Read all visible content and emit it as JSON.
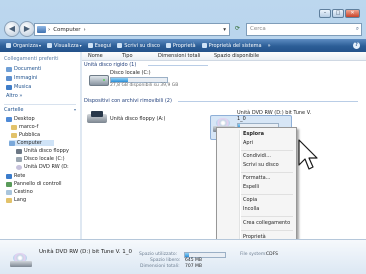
{
  "address": {
    "path": "Computer",
    "separator": "›"
  },
  "search": {
    "placeholder": "Cerca"
  },
  "caption_buttons": {
    "minimize": "–",
    "maximize": "□",
    "close": "✕"
  },
  "toolbar": {
    "items": [
      "Organizza",
      "Visualizza",
      "Esegui",
      "Scrivi su disco",
      "Proprietà",
      "Proprietà del sistema"
    ],
    "more": "»"
  },
  "nav": {
    "favorites_header": "Collegamenti preferiti",
    "favorites": [
      "Documenti",
      "Immagini",
      "Musica",
      "Altro »"
    ],
    "folders_header": "Cartelle",
    "tree": [
      "Desktop",
      "marco-f",
      "Pubblica",
      "Computer",
      "Unità disco floppy",
      "Disco locale (C:)",
      "Unità DVD RW (D:",
      "Rete",
      "Pannello di controll",
      "Cestino",
      "Lang"
    ]
  },
  "columns": [
    "Nome",
    "Tipo",
    "Dimensioni totali",
    "Spazio disponibile"
  ],
  "groups": {
    "hard_disks": "Unità disco rigido (1)",
    "removable": "Dispositivi con archivi rimovibili (2)"
  },
  "drives": {
    "c": {
      "label": "Disco locale (C:)",
      "free": "27,8 GB disponibili su 39,9 GB",
      "used_fraction": 0.3
    },
    "floppy": {
      "label": "Unità disco floppy (A:)"
    },
    "dvd": {
      "label_line1": "Unità DVD RW (D:) bit Tune V.",
      "label_line2": "1_0",
      "used_fraction": 0.05
    }
  },
  "context_menu": [
    "Esplora",
    "Apri",
    "Condividi...",
    "Scrivi su disco",
    "Formatta...",
    "Espelli",
    "Copia",
    "Incolla",
    "Crea collegamento",
    "Proprietà"
  ],
  "details": {
    "title": "Unità DVD RW (D:) bit Tune V. 1_0",
    "used_label": "Spazio utilizzato:",
    "free_label": "Spazio libero:",
    "free_value": "645 MB",
    "total_label": "Dimensioni totali:",
    "total_value": "707 MB",
    "fs_label": "File system:",
    "fs_value": "CDFS",
    "used_fraction": 0.09
  },
  "colors": {
    "toolbar": "#2c5e97",
    "bar_fill": "#2b8fd8",
    "selection": "#d7e6f6"
  }
}
